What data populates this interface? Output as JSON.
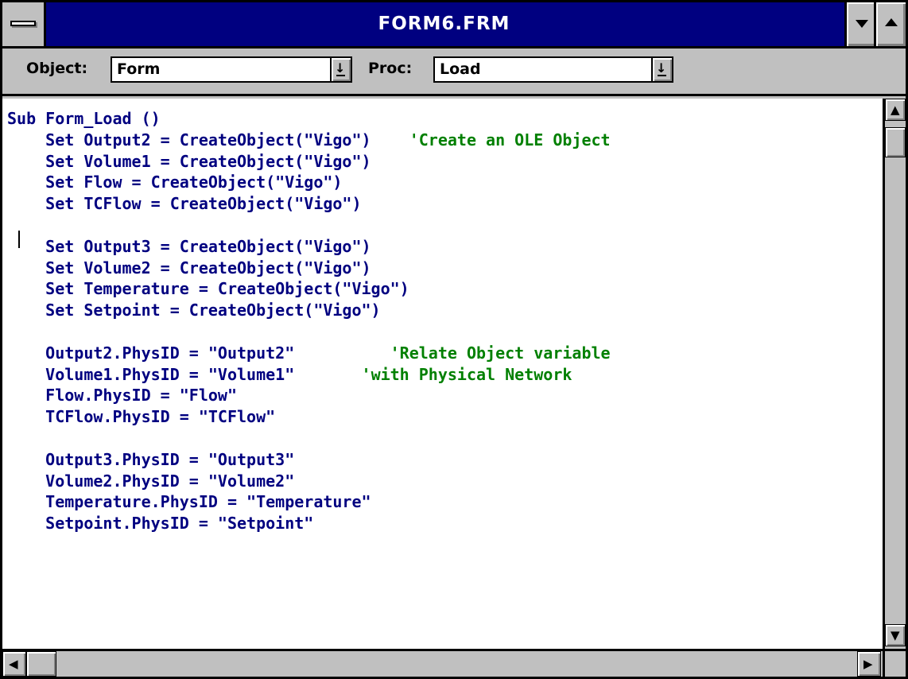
{
  "window": {
    "title": "FORM6.FRM",
    "system_menu_icon": "system-menu-icon",
    "minimize_icon": "minimize-icon",
    "maximize_icon": "maximize-icon"
  },
  "toolbar": {
    "object_label": "Object:",
    "object_value": "Form",
    "proc_label": "Proc:",
    "proc_value": "Load"
  },
  "code": {
    "lines": [
      {
        "text": "Sub Form_Load ()",
        "comment": ""
      },
      {
        "text": "    Set Output2 = CreateObject(\"Vigo\")",
        "comment": "    'Create an OLE Object"
      },
      {
        "text": "    Set Volume1 = CreateObject(\"Vigo\")",
        "comment": ""
      },
      {
        "text": "    Set Flow = CreateObject(\"Vigo\")",
        "comment": ""
      },
      {
        "text": "    Set TCFlow = CreateObject(\"Vigo\")",
        "comment": ""
      },
      {
        "text": "",
        "comment": ""
      },
      {
        "text": "    Set Output3 = CreateObject(\"Vigo\")",
        "comment": ""
      },
      {
        "text": "    Set Volume2 = CreateObject(\"Vigo\")",
        "comment": ""
      },
      {
        "text": "    Set Temperature = CreateObject(\"Vigo\")",
        "comment": ""
      },
      {
        "text": "    Set Setpoint = CreateObject(\"Vigo\")",
        "comment": ""
      },
      {
        "text": "",
        "comment": ""
      },
      {
        "text": "    Output2.PhysID = \"Output2\"",
        "comment": "          'Relate Object variable"
      },
      {
        "text": "    Volume1.PhysID = \"Volume1\"",
        "comment": "       'with Physical Network"
      },
      {
        "text": "    Flow.PhysID = \"Flow\"",
        "comment": ""
      },
      {
        "text": "    TCFlow.PhysID = \"TCFlow\"",
        "comment": ""
      },
      {
        "text": "",
        "comment": ""
      },
      {
        "text": "    Output3.PhysID = \"Output3\"",
        "comment": ""
      },
      {
        "text": "    Volume2.PhysID = \"Volume2\"",
        "comment": ""
      },
      {
        "text": "    Temperature.PhysID = \"Temperature\"",
        "comment": ""
      },
      {
        "text": "    Setpoint.PhysID = \"Setpoint\"",
        "comment": ""
      }
    ]
  },
  "scrollbars": {
    "up_icon": "▲",
    "down_icon": "▼",
    "left_icon": "◀",
    "right_icon": "▶"
  },
  "colors": {
    "title_bar": "#000080",
    "keyword_code": "#000080",
    "comment": "#008000",
    "chrome": "#c0c0c0"
  }
}
